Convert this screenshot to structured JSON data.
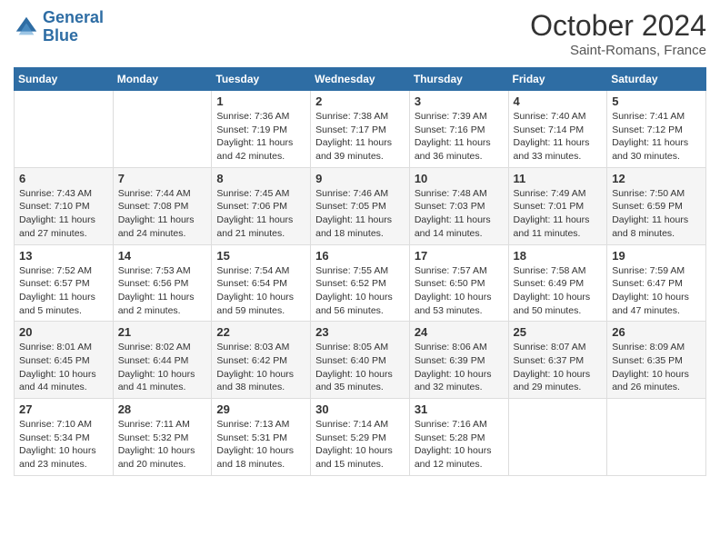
{
  "header": {
    "logo_line1": "General",
    "logo_line2": "Blue",
    "title": "October 2024",
    "subtitle": "Saint-Romans, France"
  },
  "columns": [
    "Sunday",
    "Monday",
    "Tuesday",
    "Wednesday",
    "Thursday",
    "Friday",
    "Saturday"
  ],
  "weeks": [
    [
      {
        "day": "",
        "info": ""
      },
      {
        "day": "",
        "info": ""
      },
      {
        "day": "1",
        "info": "Sunrise: 7:36 AM\nSunset: 7:19 PM\nDaylight: 11 hours and 42 minutes."
      },
      {
        "day": "2",
        "info": "Sunrise: 7:38 AM\nSunset: 7:17 PM\nDaylight: 11 hours and 39 minutes."
      },
      {
        "day": "3",
        "info": "Sunrise: 7:39 AM\nSunset: 7:16 PM\nDaylight: 11 hours and 36 minutes."
      },
      {
        "day": "4",
        "info": "Sunrise: 7:40 AM\nSunset: 7:14 PM\nDaylight: 11 hours and 33 minutes."
      },
      {
        "day": "5",
        "info": "Sunrise: 7:41 AM\nSunset: 7:12 PM\nDaylight: 11 hours and 30 minutes."
      }
    ],
    [
      {
        "day": "6",
        "info": "Sunrise: 7:43 AM\nSunset: 7:10 PM\nDaylight: 11 hours and 27 minutes."
      },
      {
        "day": "7",
        "info": "Sunrise: 7:44 AM\nSunset: 7:08 PM\nDaylight: 11 hours and 24 minutes."
      },
      {
        "day": "8",
        "info": "Sunrise: 7:45 AM\nSunset: 7:06 PM\nDaylight: 11 hours and 21 minutes."
      },
      {
        "day": "9",
        "info": "Sunrise: 7:46 AM\nSunset: 7:05 PM\nDaylight: 11 hours and 18 minutes."
      },
      {
        "day": "10",
        "info": "Sunrise: 7:48 AM\nSunset: 7:03 PM\nDaylight: 11 hours and 14 minutes."
      },
      {
        "day": "11",
        "info": "Sunrise: 7:49 AM\nSunset: 7:01 PM\nDaylight: 11 hours and 11 minutes."
      },
      {
        "day": "12",
        "info": "Sunrise: 7:50 AM\nSunset: 6:59 PM\nDaylight: 11 hours and 8 minutes."
      }
    ],
    [
      {
        "day": "13",
        "info": "Sunrise: 7:52 AM\nSunset: 6:57 PM\nDaylight: 11 hours and 5 minutes."
      },
      {
        "day": "14",
        "info": "Sunrise: 7:53 AM\nSunset: 6:56 PM\nDaylight: 11 hours and 2 minutes."
      },
      {
        "day": "15",
        "info": "Sunrise: 7:54 AM\nSunset: 6:54 PM\nDaylight: 10 hours and 59 minutes."
      },
      {
        "day": "16",
        "info": "Sunrise: 7:55 AM\nSunset: 6:52 PM\nDaylight: 10 hours and 56 minutes."
      },
      {
        "day": "17",
        "info": "Sunrise: 7:57 AM\nSunset: 6:50 PM\nDaylight: 10 hours and 53 minutes."
      },
      {
        "day": "18",
        "info": "Sunrise: 7:58 AM\nSunset: 6:49 PM\nDaylight: 10 hours and 50 minutes."
      },
      {
        "day": "19",
        "info": "Sunrise: 7:59 AM\nSunset: 6:47 PM\nDaylight: 10 hours and 47 minutes."
      }
    ],
    [
      {
        "day": "20",
        "info": "Sunrise: 8:01 AM\nSunset: 6:45 PM\nDaylight: 10 hours and 44 minutes."
      },
      {
        "day": "21",
        "info": "Sunrise: 8:02 AM\nSunset: 6:44 PM\nDaylight: 10 hours and 41 minutes."
      },
      {
        "day": "22",
        "info": "Sunrise: 8:03 AM\nSunset: 6:42 PM\nDaylight: 10 hours and 38 minutes."
      },
      {
        "day": "23",
        "info": "Sunrise: 8:05 AM\nSunset: 6:40 PM\nDaylight: 10 hours and 35 minutes."
      },
      {
        "day": "24",
        "info": "Sunrise: 8:06 AM\nSunset: 6:39 PM\nDaylight: 10 hours and 32 minutes."
      },
      {
        "day": "25",
        "info": "Sunrise: 8:07 AM\nSunset: 6:37 PM\nDaylight: 10 hours and 29 minutes."
      },
      {
        "day": "26",
        "info": "Sunrise: 8:09 AM\nSunset: 6:35 PM\nDaylight: 10 hours and 26 minutes."
      }
    ],
    [
      {
        "day": "27",
        "info": "Sunrise: 7:10 AM\nSunset: 5:34 PM\nDaylight: 10 hours and 23 minutes."
      },
      {
        "day": "28",
        "info": "Sunrise: 7:11 AM\nSunset: 5:32 PM\nDaylight: 10 hours and 20 minutes."
      },
      {
        "day": "29",
        "info": "Sunrise: 7:13 AM\nSunset: 5:31 PM\nDaylight: 10 hours and 18 minutes."
      },
      {
        "day": "30",
        "info": "Sunrise: 7:14 AM\nSunset: 5:29 PM\nDaylight: 10 hours and 15 minutes."
      },
      {
        "day": "31",
        "info": "Sunrise: 7:16 AM\nSunset: 5:28 PM\nDaylight: 10 hours and 12 minutes."
      },
      {
        "day": "",
        "info": ""
      },
      {
        "day": "",
        "info": ""
      }
    ]
  ]
}
